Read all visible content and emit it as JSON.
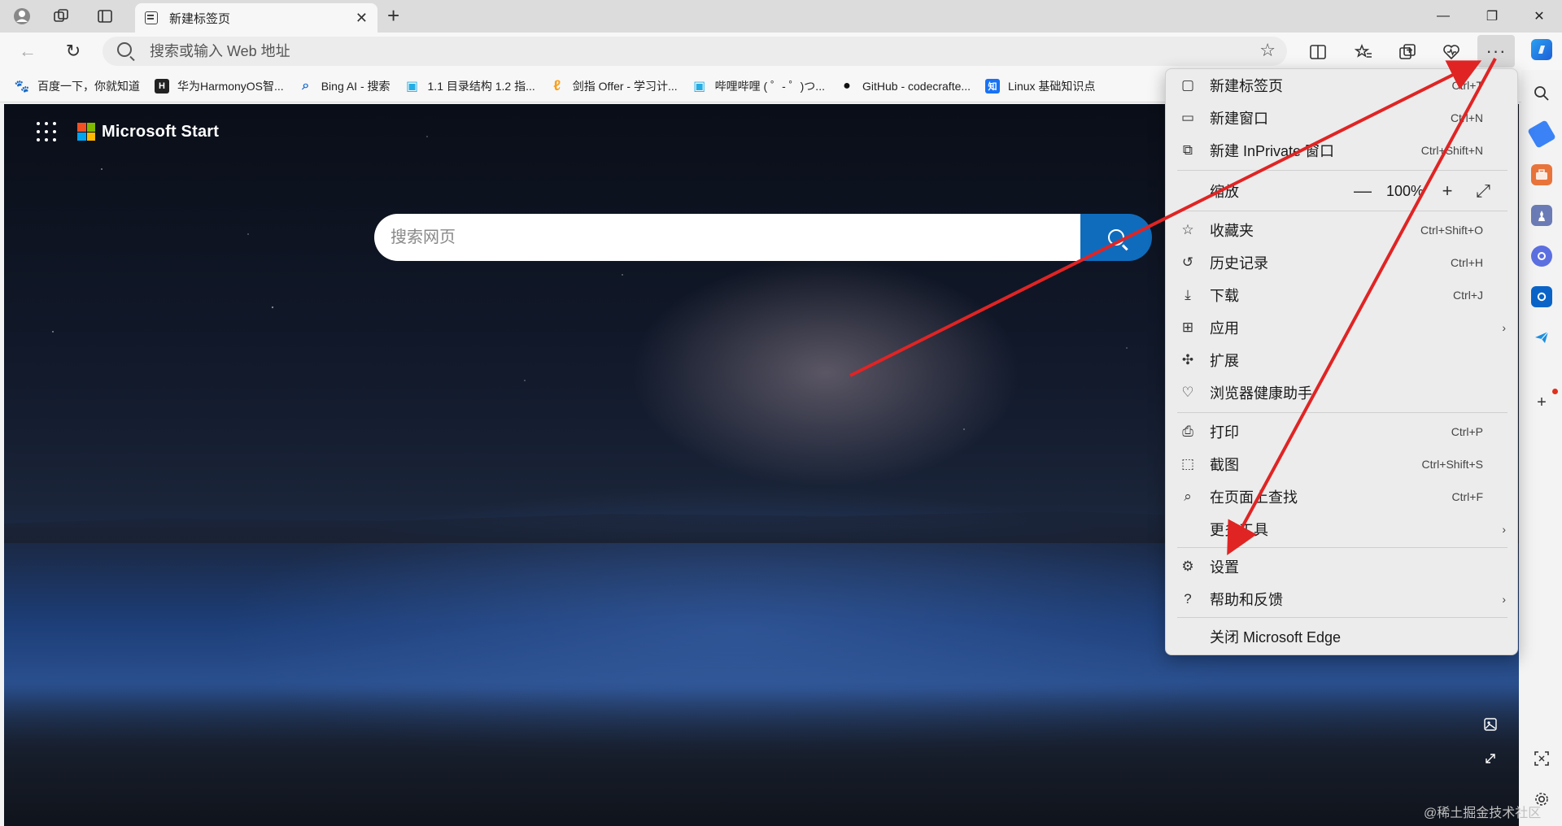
{
  "window": {
    "tab_title": "新建标签页",
    "close_tab": "✕",
    "new_tab": "+",
    "minimize": "—",
    "restore": "❐",
    "close": "✕"
  },
  "nav": {
    "back": "←",
    "refresh": "↻",
    "address_placeholder": "搜索或输入 Web 地址",
    "favorite_star": "☆",
    "more": "···"
  },
  "favorites": [
    {
      "label": "百度一下，你就知道",
      "icon": "baidu-icon",
      "color": "#2932e1",
      "glyph": "🐾"
    },
    {
      "label": "华为HarmonyOS智...",
      "icon": "harmony-icon",
      "color": "#222222",
      "glyph": "H"
    },
    {
      "label": "Bing AI - 搜索",
      "icon": "bing-search-icon",
      "color": "#1f6fd1",
      "glyph": "⌕"
    },
    {
      "label": "1.1 目录结构 1.2 指...",
      "icon": "bilibili-icon",
      "color": "#23ade5",
      "glyph": "▣"
    },
    {
      "label": "剑指 Offer - 学习计...",
      "icon": "leetcode-icon",
      "color": "#f89f1b",
      "glyph": "ℓ"
    },
    {
      "label": "哔哩哔哩 ( ゜- ゜)つ...",
      "icon": "bilibili-icon",
      "color": "#23ade5",
      "glyph": "▣"
    },
    {
      "label": "GitHub - codecrafte...",
      "icon": "github-icon",
      "color": "#111111",
      "glyph": "●"
    },
    {
      "label": "Linux 基础知识点",
      "icon": "zhihu-icon",
      "color": "#1772f6",
      "glyph": "知"
    }
  ],
  "page": {
    "brand": "Microsoft Start",
    "search_placeholder": "搜索网页"
  },
  "menu": {
    "items": [
      {
        "label": "新建标签页",
        "shortcut": "Ctrl+T",
        "icon": "new-tab-icon",
        "glyph": "▢"
      },
      {
        "label": "新建窗口",
        "shortcut": "Ctrl+N",
        "icon": "new-window-icon",
        "glyph": "▭"
      },
      {
        "label": "新建 InPrivate 窗口",
        "shortcut": "Ctrl+Shift+N",
        "icon": "inprivate-icon",
        "glyph": "⧉"
      },
      {
        "label": "缩放",
        "icon": "",
        "glyph": ""
      },
      {
        "label": "收藏夹",
        "shortcut": "Ctrl+Shift+O",
        "icon": "favorites-icon",
        "glyph": "☆"
      },
      {
        "label": "历史记录",
        "shortcut": "Ctrl+H",
        "icon": "history-icon",
        "glyph": "↺"
      },
      {
        "label": "下载",
        "shortcut": "Ctrl+J",
        "icon": "download-icon",
        "glyph": "⤓"
      },
      {
        "label": "应用",
        "icon": "apps-icon",
        "glyph": "⊞"
      },
      {
        "label": "扩展",
        "icon": "extensions-icon",
        "glyph": "✣"
      },
      {
        "label": "浏览器健康助手",
        "icon": "health-icon",
        "glyph": "♡"
      },
      {
        "label": "打印",
        "shortcut": "Ctrl+P",
        "icon": "print-icon",
        "glyph": "⎙"
      },
      {
        "label": "截图",
        "shortcut": "Ctrl+Shift+S",
        "icon": "screenshot-icon",
        "glyph": "⬚"
      },
      {
        "label": "在页面上查找",
        "shortcut": "Ctrl+F",
        "icon": "find-icon",
        "glyph": "⌕"
      },
      {
        "label": "更多工具",
        "icon": "",
        "glyph": ""
      },
      {
        "label": "设置",
        "icon": "settings-icon",
        "glyph": "⚙"
      },
      {
        "label": "帮助和反馈",
        "icon": "help-icon",
        "glyph": "?"
      },
      {
        "label": "关闭 Microsoft Edge",
        "icon": "",
        "glyph": ""
      }
    ],
    "zoom": {
      "minus": "—",
      "value": "100%",
      "plus": "+",
      "fullscreen": "⤢"
    },
    "submenu_arrow": "›"
  },
  "sidebar": {
    "add": "+"
  },
  "watermark": "@稀土掘金技术社区",
  "colors": {
    "accent": "#0f6cbd",
    "annotation_arrow": "#e02424"
  }
}
